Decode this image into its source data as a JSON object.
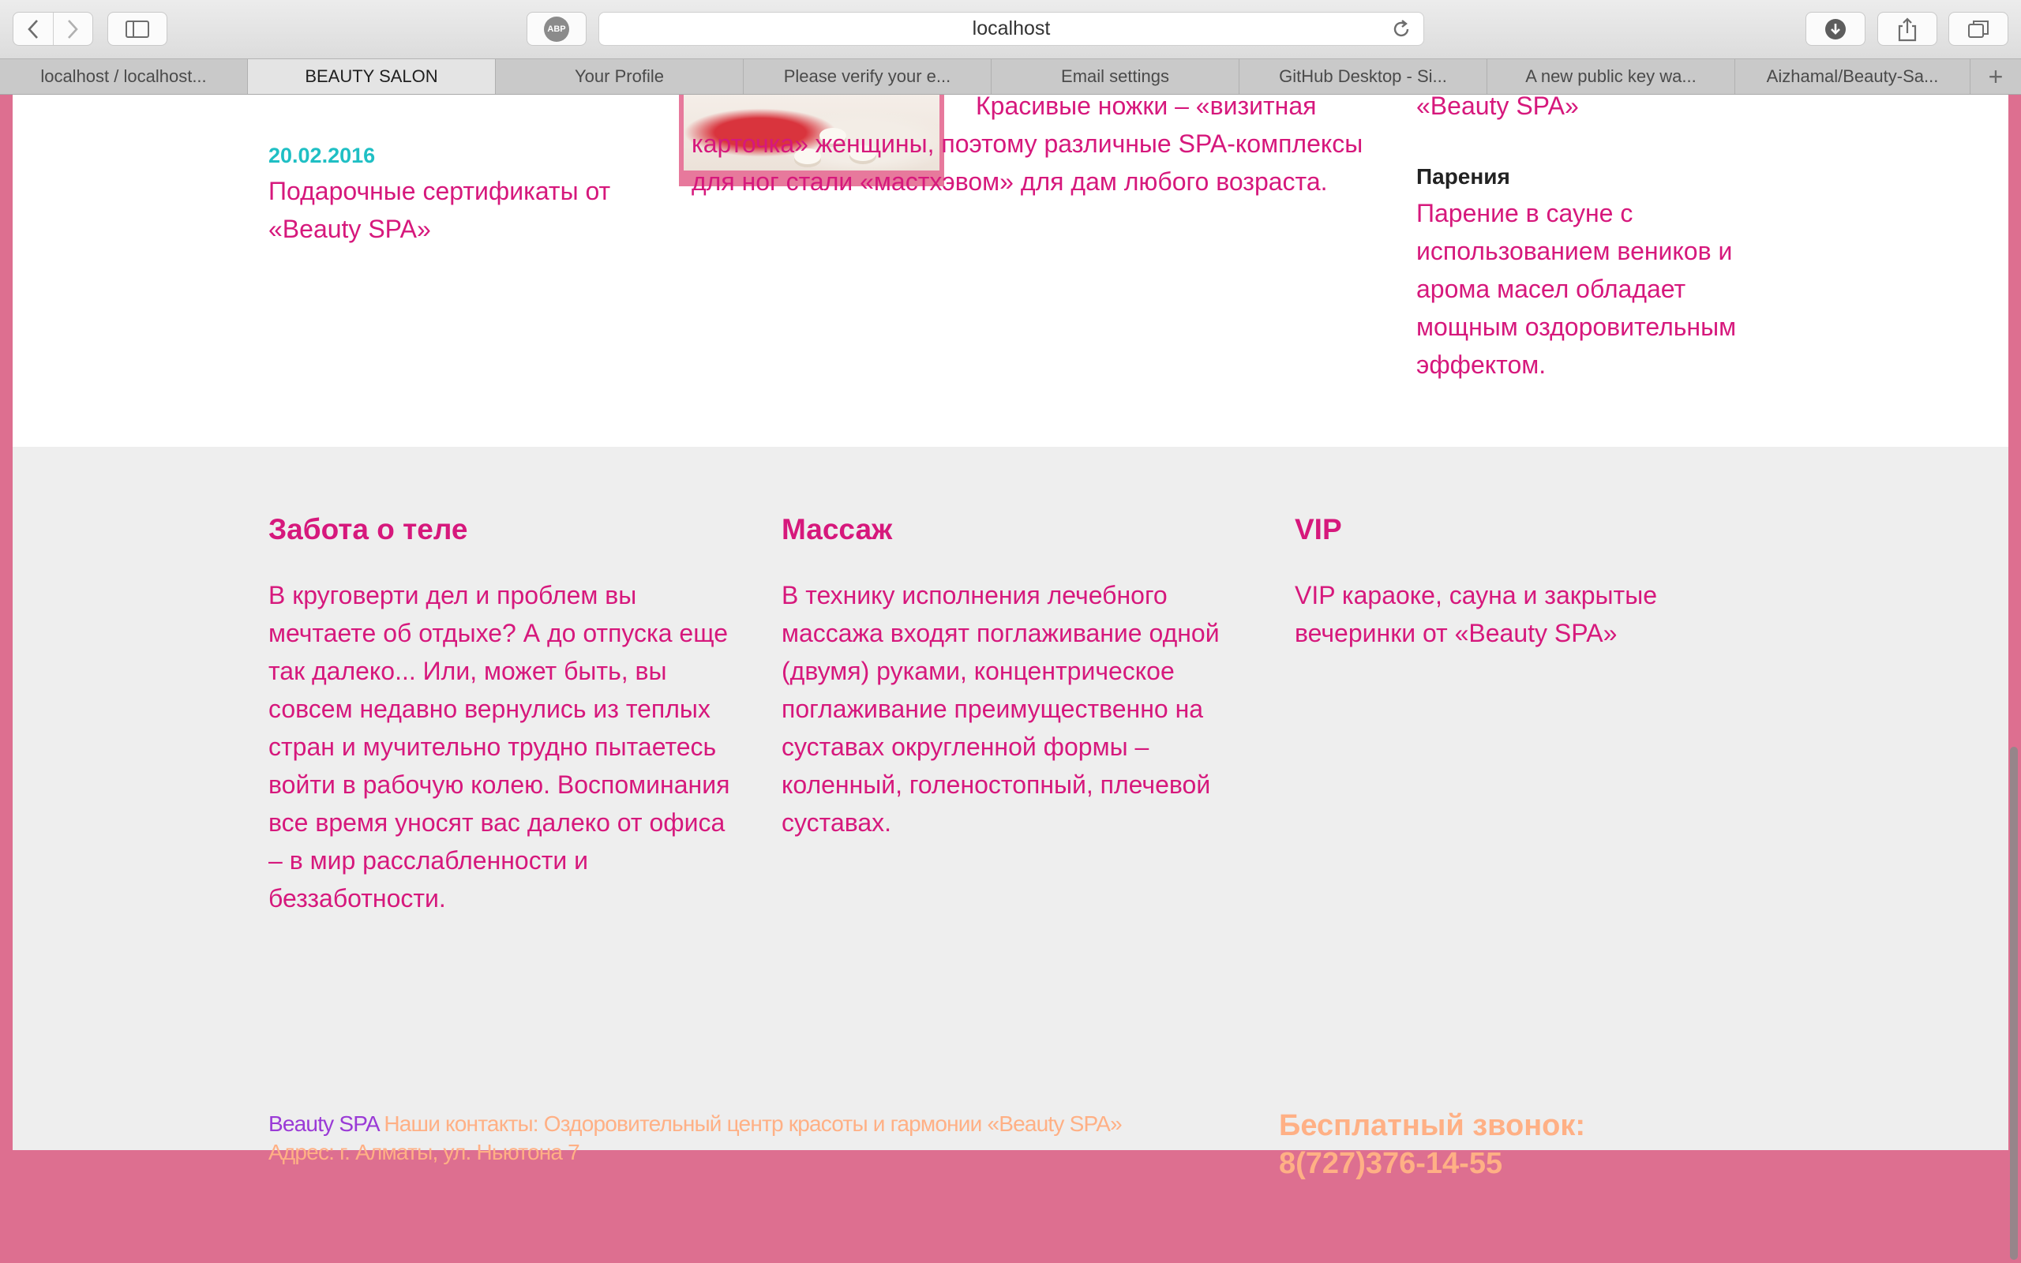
{
  "browser": {
    "url": "localhost",
    "abp_label": "ABP",
    "tabs": [
      {
        "label": "localhost / localhost..."
      },
      {
        "label": "BEAUTY SALON"
      },
      {
        "label": "Your Profile"
      },
      {
        "label": "Please verify your e..."
      },
      {
        "label": "Email settings"
      },
      {
        "label": "GitHub Desktop - Si..."
      },
      {
        "label": "A new public key wa..."
      },
      {
        "label": "Aizhamal/Beauty-Sa..."
      }
    ],
    "new_tab_label": "+"
  },
  "news": {
    "date": "20.02.2016",
    "title": "Подарочные сертификаты от «Beauty SPA»",
    "legs_text": "Красивые ножки – «визитная карточка» женщины, поэтому различные SPA-комплексы для ног стали «мастхэвом» для дам любого возраста.",
    "sauna_top": "«Beauty SPA»",
    "sauna_heading": "Парения",
    "sauna_text": "Парение в сауне с использованием веников и арома масел обладает мощным оздоровительным эффектом."
  },
  "services": [
    {
      "title": "Забота о теле",
      "text": "В круговерти дел и проблем вы мечтаете об отдыхе? А до отпуска еще так далеко... Или, может быть, вы совсем недавно вернулись из теплых стран и мучительно трудно пытаетесь войти в рабочую колею. Воспоминания все время уносят вас далеко от офиса – в мир расслабленности и беззаботности."
    },
    {
      "title": "Массаж",
      "text": "В технику исполнения лечебного массажа входят поглаживание одной (двумя) руками, концентрическое поглаживание преимущественно на суставах округленной формы – коленный, голеностопный, плечевой суставах."
    },
    {
      "title": "VIP",
      "text": "VIP караоке, сауна и закрытые вечеринки от «Beauty SPA»"
    }
  ],
  "footer": {
    "brand": "Beauty SPA",
    "contacts": " Наши контакты: Оздоровительный центр красоты и гармонии «Beauty SPA»",
    "address": "Адрес: г. Алматы, ул. Ньютона 7",
    "call_label": "Бесплатный звонок:",
    "phone": "8(727)376-14-55"
  },
  "colors": {
    "page_pink": "#dd6f90",
    "text_magenta": "#d6187c",
    "date_teal": "#1fbfc4",
    "footer_orange": "#ffb085",
    "brand_purple": "#9a3ad6"
  }
}
